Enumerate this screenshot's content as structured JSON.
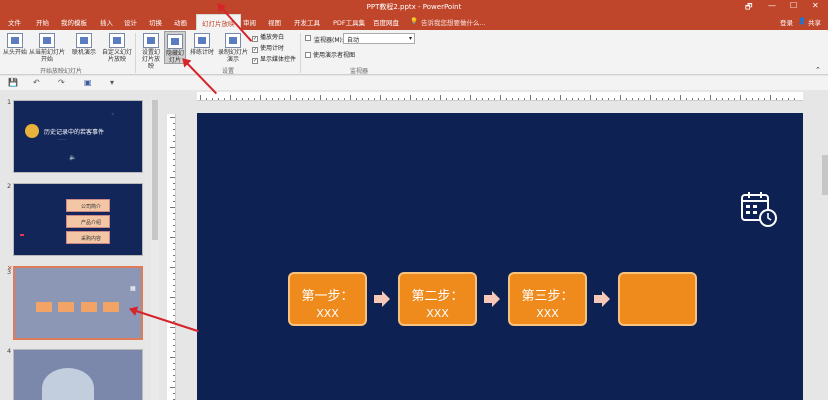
{
  "window": {
    "title": "PPT教程2.pptx - PowerPoint",
    "controls": [
      "🗗",
      "—",
      "☐",
      "✕"
    ]
  },
  "tabs": [
    "文件",
    "开始",
    "我的模板",
    "插入",
    "设计",
    "切换",
    "动画",
    "幻灯片放映",
    "审阅",
    "视图",
    "开发工具",
    "PDF工具集",
    "百度网盘"
  ],
  "active_tab": "幻灯片放映",
  "tell_me": "告诉我您想要做什么...",
  "account": {
    "login": "登录",
    "share": "共享"
  },
  "ribbon": {
    "from_start": "从头开始",
    "from_current": "从当前幻灯片开始",
    "online": "联机演示",
    "custom": "自定义幻灯片放映",
    "group_start": "开始放映幻灯片",
    "setup": "设置幻灯片放映",
    "hide": "隐藏幻灯片",
    "rehearse": "排练计时",
    "record": "录制幻灯片演示",
    "group_setup": "设置",
    "cb_narration": "播放旁白",
    "cb_timings": "使用计时",
    "cb_media": "显示媒体控件",
    "monitor_label": "监视器(M):",
    "monitor_value": "自动",
    "presenter_view": "使用演示者视图",
    "group_monitor": "监视器"
  },
  "slides": [
    {
      "num": "1",
      "title": "历史记录中的若客事件",
      "subtitle": "……",
      "speaker": "🔈"
    },
    {
      "num": "2",
      "items": [
        "公司简介",
        "产品介绍",
        "采购内容"
      ]
    },
    {
      "num": "3"
    },
    {
      "num": "4"
    }
  ],
  "main_slide": {
    "steps": [
      {
        "title": "第一步：",
        "sub": "XXX"
      },
      {
        "title": "第二步：",
        "sub": "XXX"
      },
      {
        "title": "第三步：",
        "sub": "XXX"
      },
      {
        "title": "",
        "sub": ""
      }
    ]
  },
  "colors": {
    "accent": "#c0462b",
    "slide_bg": "#0d2253",
    "step": "#ef8a1c",
    "annot": "#d6242a"
  }
}
